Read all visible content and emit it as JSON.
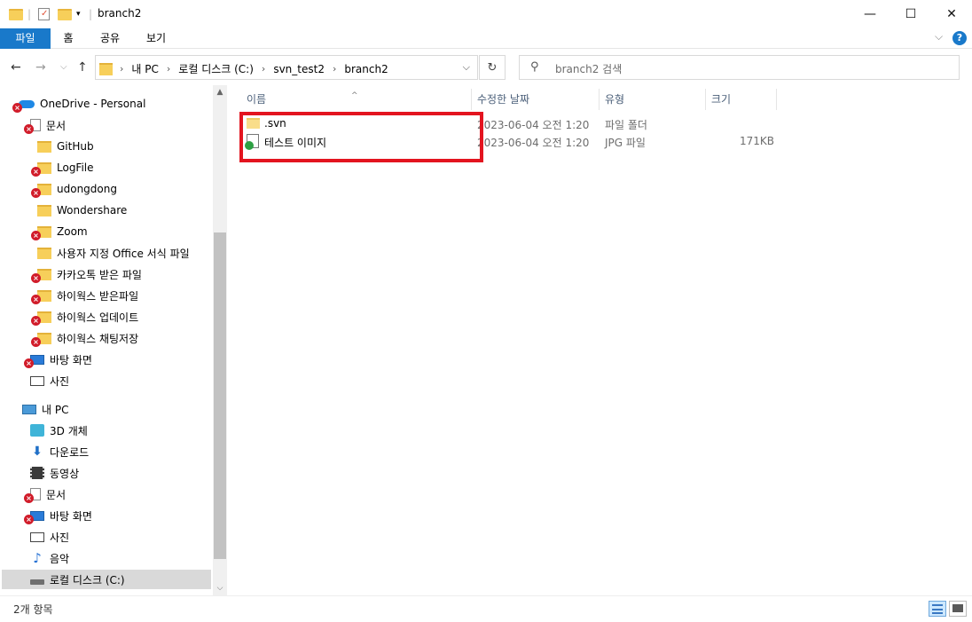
{
  "window": {
    "title": "branch2",
    "minimize": "—",
    "maximize": "☐",
    "close": "✕"
  },
  "ribbon": {
    "tabs": [
      "파일",
      "홈",
      "공유",
      "보기"
    ],
    "expand_icon": "⌵",
    "help_icon": "?"
  },
  "nav": {
    "back": "←",
    "forward": "→",
    "recent": "⌵",
    "up": "↑",
    "breadcrumbs": [
      "내 PC",
      "로컬 디스크 (C:)",
      "svn_test2",
      "branch2"
    ],
    "dropdown": "⌵",
    "refresh": "↻",
    "search_placeholder": "branch2 검색"
  },
  "sidebar": {
    "items": [
      {
        "label": "OneDrive - Personal",
        "icon": "cloud-icon",
        "badge": true
      },
      {
        "label": "문서",
        "icon": "document-icon",
        "badge": true
      },
      {
        "label": "GitHub",
        "icon": "folder-icon",
        "badge": false
      },
      {
        "label": "LogFile",
        "icon": "folder-icon",
        "badge": true
      },
      {
        "label": "udongdong",
        "icon": "folder-icon",
        "badge": true
      },
      {
        "label": "Wondershare",
        "icon": "folder-icon",
        "badge": false
      },
      {
        "label": "Zoom",
        "icon": "folder-icon",
        "badge": true
      },
      {
        "label": "사용자 지정 Office 서식 파일",
        "icon": "folder-icon",
        "badge": false
      },
      {
        "label": "카카오톡 받은 파일",
        "icon": "folder-icon",
        "badge": true
      },
      {
        "label": "하이웍스 받은파일",
        "icon": "folder-icon",
        "badge": true
      },
      {
        "label": "하이웍스 업데이트",
        "icon": "folder-icon",
        "badge": true
      },
      {
        "label": "하이웍스 채팅저장",
        "icon": "folder-icon",
        "badge": true
      },
      {
        "label": "바탕 화면",
        "icon": "desktop-icon",
        "badge": true
      },
      {
        "label": "사진",
        "icon": "pictures-icon",
        "badge": false
      },
      {
        "label": "내 PC",
        "icon": "pc-icon",
        "badge": false
      },
      {
        "label": "3D 개체",
        "icon": "3d-objects-icon",
        "badge": false
      },
      {
        "label": "다운로드",
        "icon": "download-icon",
        "badge": false
      },
      {
        "label": "동영상",
        "icon": "video-icon",
        "badge": false
      },
      {
        "label": "문서",
        "icon": "document-icon",
        "badge": true
      },
      {
        "label": "바탕 화면",
        "icon": "desktop-icon",
        "badge": true
      },
      {
        "label": "사진",
        "icon": "pictures-icon",
        "badge": false
      },
      {
        "label": "음악",
        "icon": "music-icon",
        "badge": false
      },
      {
        "label": "로컬 디스크 (C:)",
        "icon": "drive-icon",
        "badge": false,
        "selected": true
      }
    ]
  },
  "filelist": {
    "columns": [
      "이름",
      "수정한 날짜",
      "유형",
      "크기"
    ],
    "sort_indicator": "^",
    "rows": [
      {
        "name": ".svn",
        "date": "2023-06-04 오전 1:20",
        "type": "파일 폴더",
        "size": "",
        "icon": "folder-icon"
      },
      {
        "name": "테스트 이미지",
        "date": "2023-06-04 오전 1:20",
        "type": "JPG 파일",
        "size": "171KB",
        "icon": "jpg-file-icon"
      }
    ]
  },
  "status": {
    "item_count": "2개 항목"
  },
  "colors": {
    "accent": "#1979ca",
    "highlight_box": "#e3141f",
    "error_badge": "#d11c2a"
  }
}
